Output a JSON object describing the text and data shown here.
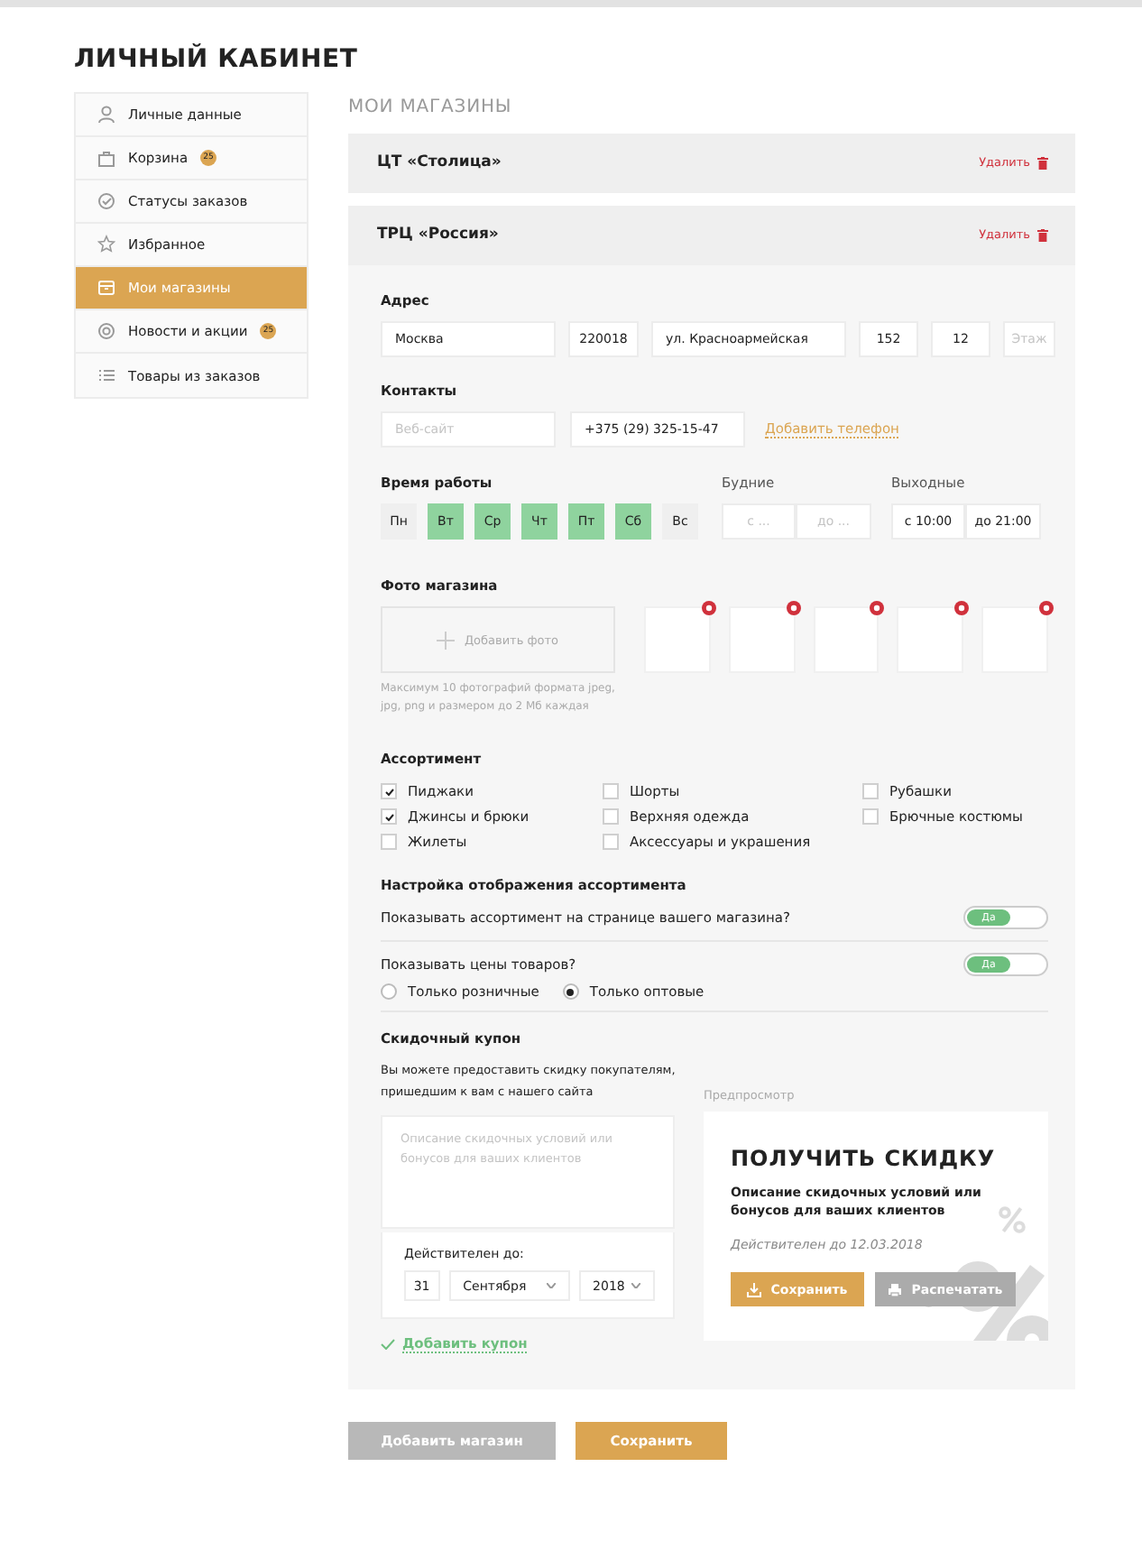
{
  "page_title": "ЛИЧНЫЙ КАБИНЕТ",
  "sidebar": [
    {
      "label": "Личные данные",
      "selected": false
    },
    {
      "label": "Корзина",
      "badge": "25",
      "selected": false
    },
    {
      "label": "Статусы заказов",
      "selected": false
    },
    {
      "label": "Избранное",
      "selected": false
    },
    {
      "label": "Мои магазины",
      "selected": true
    },
    {
      "label": "Новости и акции",
      "badge": "25",
      "selected": false
    },
    {
      "label": "Товары из заказов",
      "selected": false
    }
  ],
  "section_title": "МОИ МАГАЗИНЫ",
  "stores": [
    {
      "name": "ЦТ «Столица»",
      "delete_label": "Удалить"
    },
    {
      "name": "ТРЦ «Россия»",
      "delete_label": "Удалить",
      "form": {
        "address": {
          "label": "Адрес",
          "fields": [
            {
              "value": "Москва"
            },
            {
              "value": "220018"
            },
            {
              "value": "ул. Красноармейская"
            },
            {
              "value": "152"
            },
            {
              "value": "12"
            },
            {
              "placeholder": "Этаж"
            }
          ]
        },
        "contacts": {
          "label": "Контакты",
          "fields": [
            {
              "placeholder": "Веб-сайт"
            },
            {
              "value": "+375 (29) 325-15-47"
            }
          ],
          "add_link": "Добавить телефон"
        },
        "hours": {
          "label": "Время работы",
          "days": [
            {
              "label": "Пн",
              "selected": false
            },
            {
              "label": "Вт",
              "selected": true
            },
            {
              "label": "Ср",
              "selected": true
            },
            {
              "label": "Чт",
              "selected": true
            },
            {
              "label": "Пт",
              "selected": true
            },
            {
              "label": "Сб",
              "selected": true
            },
            {
              "label": "Вс",
              "selected": false
            }
          ],
          "ranges": [
            {
              "label": "Будние",
              "from": {
                "placeholder": "с ..."
              },
              "to": {
                "placeholder": "до ..."
              }
            },
            {
              "label": "Выходные",
              "from": {
                "value": "с 10:00"
              },
              "to": {
                "value": "до 21:00"
              }
            }
          ]
        },
        "photos": {
          "label": "Фото магазина",
          "add_label": "Добавить фото",
          "hint": "Максимум 10 фотографий формата jpeg, jpg, png и размером до 2 Мб каждая",
          "slots": [
            {
              "removable": true
            },
            {
              "removable": true
            },
            {
              "removable": true
            },
            {
              "removable": true
            },
            {
              "removable": true
            }
          ]
        },
        "assortment": {
          "label": "Ассортимент",
          "items": [
            {
              "label": "Пиджаки",
              "checked": true
            },
            {
              "label": "Шорты",
              "checked": false
            },
            {
              "label": "Рубашки",
              "checked": false
            },
            {
              "label": "Джинсы и брюки",
              "checked": true
            },
            {
              "label": "Верхняя одежда",
              "checked": false
            },
            {
              "label": "Брючные костюмы",
              "checked": false
            },
            {
              "label": "Жилеты",
              "checked": false
            },
            {
              "label": "Аксессуары и украшения",
              "checked": false
            }
          ]
        },
        "display": {
          "label": "Настройка отображения ассортимента",
          "rows": [
            {
              "question": "Показывать ассортимент на странице вашего магазина?",
              "toggle": {
                "on": true,
                "label": "Да"
              }
            },
            {
              "question": "Показывать цены товаров?",
              "toggle": {
                "on": true,
                "label": "Да"
              },
              "options": [
                {
                  "label": "Только розничные",
                  "selected": false
                },
                {
                  "label": "Только оптовые",
                  "selected": true
                }
              ]
            }
          ]
        },
        "coupon": {
          "label": "Скидочный купон",
          "description": "Вы можете предоставить скидку покупателям, пришедшим к вам с нашего сайта",
          "placeholder": "Описание скидочных условий или бонусов для ваших клиентов",
          "valid_label": "Действителен до:",
          "day": "31",
          "month": "Сентября",
          "year": "2018",
          "add_link": "Добавить купон",
          "preview": {
            "label": "Предпросмотр",
            "title": "ПОЛУЧИТЬ СКИДКУ",
            "text": "Описание скидочных условий или бонусов для ваших клиентов",
            "validity": "Действителен до 12.03.2018",
            "buttons": [
              {
                "label": "Сохранить",
                "kind": "primary"
              },
              {
                "label": "Распечатать",
                "kind": "secondary"
              }
            ]
          }
        }
      }
    }
  ],
  "actions": [
    {
      "label": "Добавить магазин",
      "kind": "secondary"
    },
    {
      "label": "Сохранить",
      "kind": "primary"
    }
  ]
}
